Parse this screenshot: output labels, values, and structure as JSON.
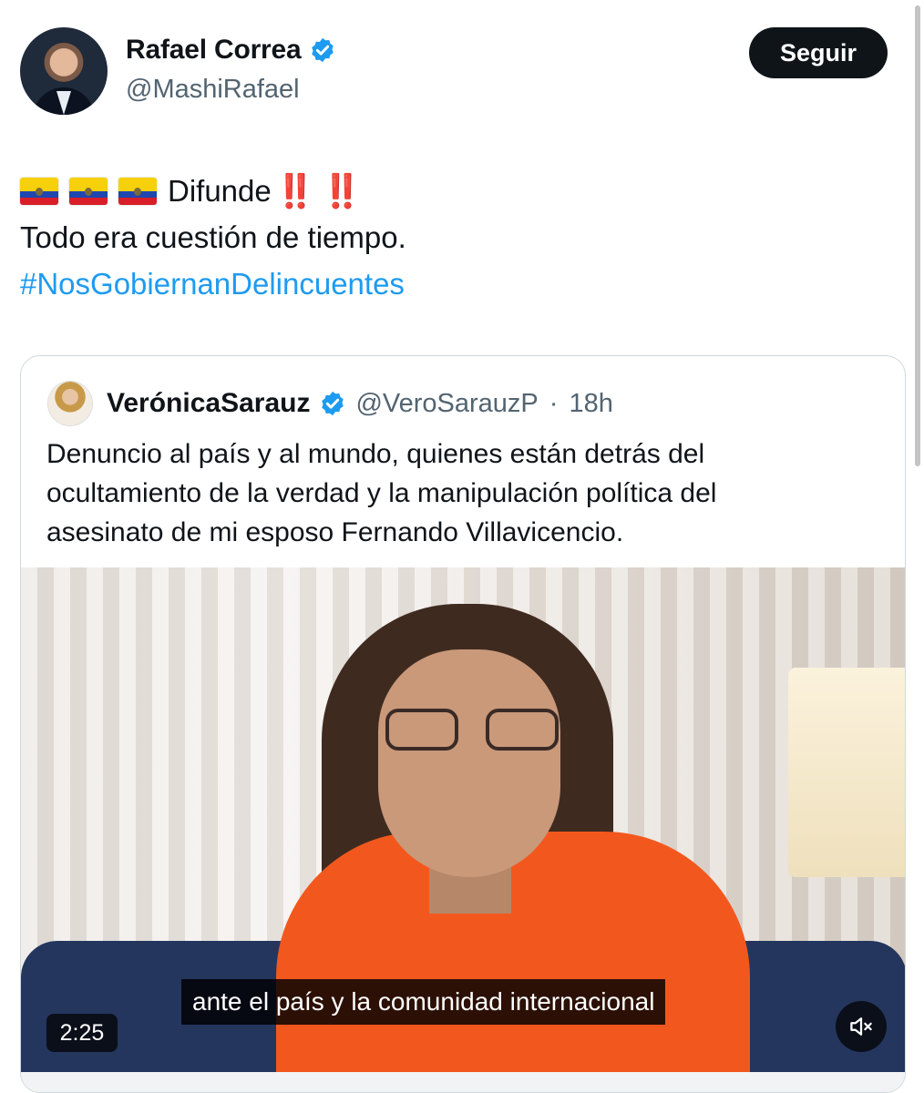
{
  "author": {
    "display_name": "Rafael Correa",
    "handle": "@MashiRafael",
    "verified_icon": "verified-badge-icon",
    "follow_label": "Seguir"
  },
  "tweet": {
    "flags": [
      "Ecuador flag",
      "Ecuador flag",
      "Ecuador flag"
    ],
    "line1_text": "Difunde",
    "line1_marks": "‼️ ‼️",
    "line2": "Todo era cuestión de tiempo.",
    "hashtag": "#NosGobiernanDelincuentes"
  },
  "quoted": {
    "display_name": "VerónicaSarauz",
    "handle": "@VeroSarauzP",
    "separator": "·",
    "time": "18h",
    "text_lines": [
      "Denuncio al país y al mundo, quienes están detrás del",
      "ocultamiento de la verdad y la manipulación política del",
      "asesinato de mi esposo Fernando Villavicencio."
    ],
    "video": {
      "caption": "ante el país y la comunidad internacional",
      "duration": "2:25",
      "mute_icon": "muted-speaker-icon"
    }
  },
  "colors": {
    "text": "#0f1419",
    "secondary": "#536471",
    "link": "#1d9bf0",
    "verified": "#1d9bf0",
    "follow_bg": "#0f1419",
    "border": "#cfd9de"
  }
}
